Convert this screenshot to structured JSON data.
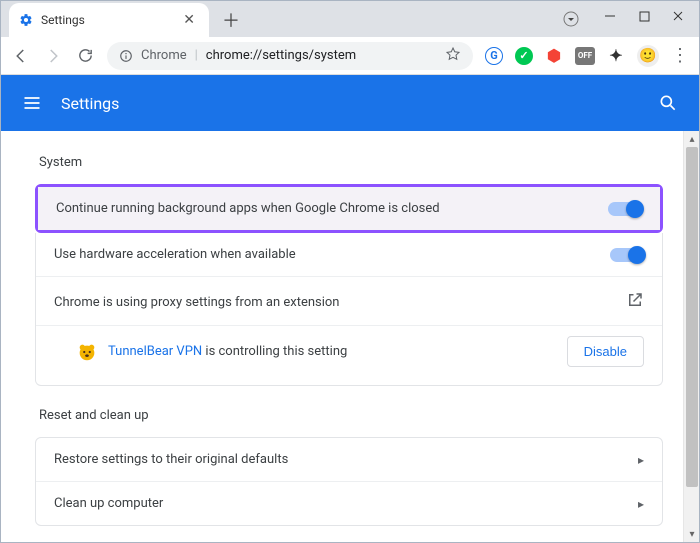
{
  "window": {
    "tab_title": "Settings",
    "new_tab_tooltip": "New tab"
  },
  "address_bar": {
    "prefix": "Chrome",
    "path": "chrome://settings/system"
  },
  "header": {
    "title": "Settings"
  },
  "sections": {
    "system": {
      "title": "System",
      "bg_apps": "Continue running background apps when Google Chrome is closed",
      "hw_accel": "Use hardware acceleration when available",
      "proxy": "Chrome is using proxy settings from an extension",
      "proxy_ext_name": "TunnelBear VPN",
      "proxy_ext_suffix": " is controlling this setting",
      "disable_btn": "Disable"
    },
    "reset": {
      "title": "Reset and clean up",
      "restore": "Restore settings to their original defaults",
      "cleanup": "Clean up computer"
    }
  }
}
